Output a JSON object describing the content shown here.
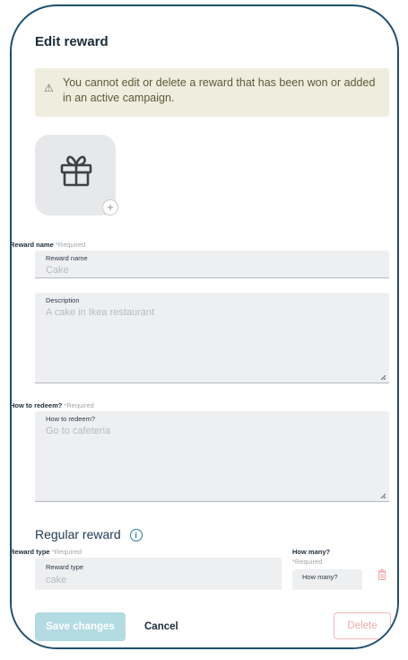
{
  "header": {
    "title": "Edit reward"
  },
  "warning": {
    "icon": "warning-icon",
    "text": "You cannot edit or delete a reward that has been won or added in an active campaign."
  },
  "image": {
    "icon": "gift-icon",
    "add_icon": "plus-icon",
    "add_symbol": "+"
  },
  "reward_name": {
    "label": "Reward name",
    "required": "*Required",
    "inner_label": "Reward name",
    "value": "Cake"
  },
  "description": {
    "inner_label": "Description",
    "value": "A cake in Ikea restaurant"
  },
  "how_to_redeem": {
    "label": "How to redeem?",
    "required": "*Required",
    "inner_label": "How to redeem?",
    "value": "Go to cafeteria"
  },
  "regular_reward": {
    "section_title": "Regular reward",
    "info_symbol": "i",
    "reward_type": {
      "label": "Reward type",
      "required": "*Required",
      "inner_label": "Reward type",
      "value": "cake"
    },
    "how_many": {
      "label": "How many?",
      "required": "*Required",
      "inner_label": "How many?"
    }
  },
  "footer": {
    "save_label": "Save changes",
    "cancel_label": "Cancel",
    "delete_label": "Delete"
  },
  "colors": {
    "accent": "#2f7d96",
    "border": "#1e4f6e",
    "save_disabled": "#b3dbe2",
    "delete": "#f1a9a9"
  }
}
